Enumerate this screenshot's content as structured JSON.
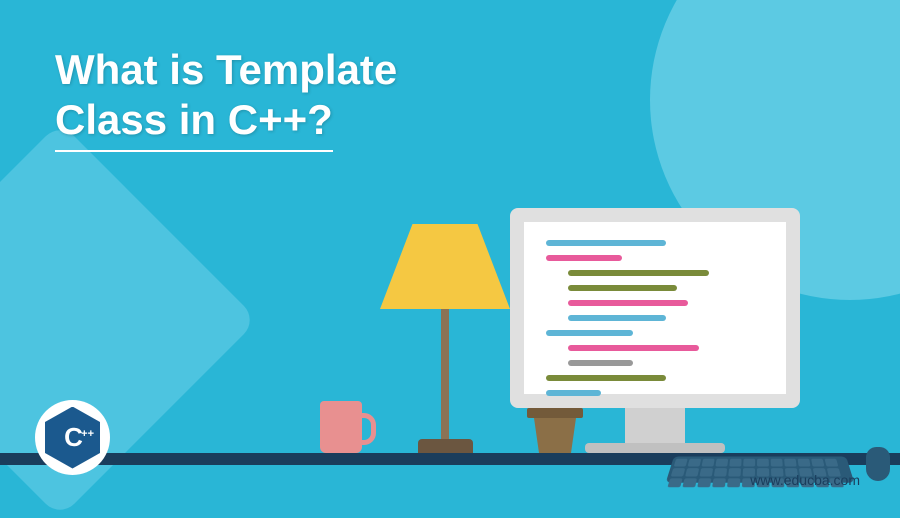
{
  "title_line1": "What is Template",
  "title_line2": "Class in C++?",
  "logo": {
    "letter": "C",
    "plus": "++"
  },
  "website": "www.educba.com",
  "code_lines": [
    {
      "color": "#5eb5d6",
      "width": "55%",
      "indent": "0"
    },
    {
      "color": "#e85a9b",
      "width": "35%",
      "indent": "0"
    },
    {
      "color": "#7a8b3a",
      "width": "65%",
      "indent": "10%"
    },
    {
      "color": "#7a8b3a",
      "width": "50%",
      "indent": "10%"
    },
    {
      "color": "#e85a9b",
      "width": "55%",
      "indent": "10%"
    },
    {
      "color": "#5eb5d6",
      "width": "45%",
      "indent": "10%"
    },
    {
      "color": "#5eb5d6",
      "width": "40%",
      "indent": "0"
    },
    {
      "color": "#e85a9b",
      "width": "60%",
      "indent": "10%"
    },
    {
      "color": "#999",
      "width": "30%",
      "indent": "10%"
    },
    {
      "color": "#7a8b3a",
      "width": "55%",
      "indent": "0"
    },
    {
      "color": "#5eb5d6",
      "width": "25%",
      "indent": "0"
    }
  ]
}
